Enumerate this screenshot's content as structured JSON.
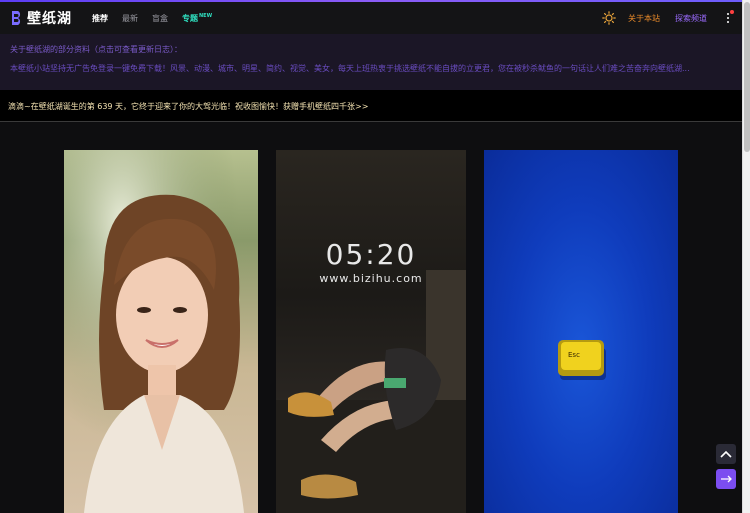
{
  "nav": {
    "logo_text": "壁纸湖",
    "links": [
      {
        "label": "推荐"
      },
      {
        "label": "最新"
      },
      {
        "label": "盲盒"
      },
      {
        "label": "专题"
      }
    ],
    "new_badge": "NEW",
    "about_label": "关于本站",
    "explore_label": "探索频道"
  },
  "info": {
    "title": "关于壁纸湖的部分资料（点击可查看更新日志）：",
    "text": "本壁纸小站坚持无广告免登录一键免费下载！风景、动漫、城市、明星、简约、视觉、美女，每天上班热衷于挑选壁纸不能自拔的立更君，您在被秒杀鱿鱼的一句话让人们难之苦奋奔向壁纸湖..."
  },
  "announcement": "滴滴~在壁纸湖诞生的第 639 天，它终于迎来了你的大驾光临！祝收图愉快！获赠手机壁纸四千张>>",
  "wallpapers": [
    {
      "alt": "portrait-girl"
    },
    {
      "time": "05:20",
      "site": "www.bizihu.com"
    },
    {
      "key_label": "Esc"
    }
  ],
  "colors": {
    "accent": "#7b4df0",
    "about": "#e98a2a",
    "explore": "#9b6bff",
    "special": "#2fe0c0"
  }
}
